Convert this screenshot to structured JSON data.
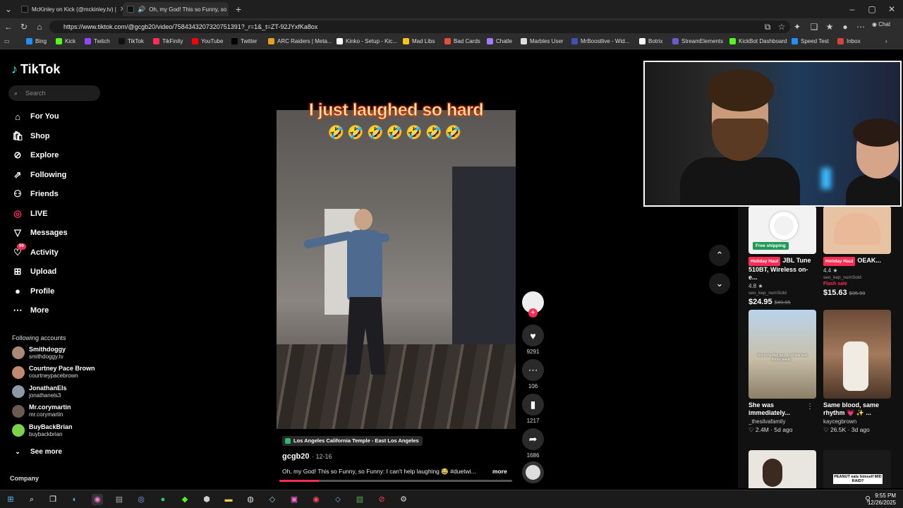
{
  "tabs": [
    {
      "title": "McKinley on Kick (@mckinley.tv) |",
      "active": false
    },
    {
      "title": "Oh, my God! This so Funny, so",
      "active": true
    }
  ],
  "address": {
    "url": "https://www.tiktok.com/@gcgb20/video/7584343207320751391?_r=1&_t=ZT-92JYxfKa8ox"
  },
  "bookmarks": [
    {
      "label": "Bing",
      "color": "#1e90ff"
    },
    {
      "label": "Kick",
      "color": "#53fc18"
    },
    {
      "label": "Twitch",
      "color": "#9146ff"
    },
    {
      "label": "TikTok",
      "color": "#111111"
    },
    {
      "label": "TikFinity",
      "color": "#fe2c55"
    },
    {
      "label": "YouTube",
      "color": "#ff0000"
    },
    {
      "label": "Twitter",
      "color": "#000000"
    },
    {
      "label": "ARC Raiders | Meta...",
      "color": "#e4a11b"
    },
    {
      "label": "Kinko - Setup - Kic...",
      "color": "#ffffff"
    },
    {
      "label": "Mad Libs",
      "color": "#f5c518"
    },
    {
      "label": "Bad Cards",
      "color": "#e74c3c"
    },
    {
      "label": "Chatle",
      "color": "#a27bff"
    },
    {
      "label": "Marbles User",
      "color": "#dddddd"
    },
    {
      "label": "MrBoostlive - Wid...",
      "color": "#3f51b5"
    },
    {
      "label": "Botrix",
      "color": "#ffffff"
    },
    {
      "label": "StreamElements",
      "color": "#6a5acd"
    },
    {
      "label": "KickBot Dashboard",
      "color": "#53fc18"
    },
    {
      "label": "Speed Test",
      "color": "#1e90ff"
    },
    {
      "label": "Inbox",
      "color": "#d44638"
    }
  ],
  "sidebar": {
    "logo": "TikTok",
    "search_placeholder": "Search",
    "nav": [
      {
        "label": "For You",
        "icon": "home-icon"
      },
      {
        "label": "Shop",
        "icon": "shop-icon"
      },
      {
        "label": "Explore",
        "icon": "compass-icon"
      },
      {
        "label": "Following",
        "icon": "following-icon"
      },
      {
        "label": "Friends",
        "icon": "friends-icon"
      },
      {
        "label": "LIVE",
        "icon": "live-icon"
      },
      {
        "label": "Messages",
        "icon": "messages-icon"
      },
      {
        "label": "Activity",
        "icon": "activity-icon",
        "badge": "50"
      },
      {
        "label": "Upload",
        "icon": "upload-icon"
      },
      {
        "label": "Profile",
        "icon": "profile-icon"
      },
      {
        "label": "More",
        "icon": "more-icon"
      }
    ],
    "following_title": "Following accounts",
    "following": [
      {
        "name": "Smithdoggy",
        "handle": "smithdoggy.tv"
      },
      {
        "name": "Courtney Pace Brown",
        "handle": "courtneypacebrown"
      },
      {
        "name": "JonathanEls",
        "handle": "jonathanels3"
      },
      {
        "name": "Mr.corymartin",
        "handle": "mr.corymartin"
      },
      {
        "name": "BuyBackBrian",
        "handle": "buybackbrian"
      }
    ],
    "see_more": "See more",
    "company": "Company"
  },
  "video": {
    "caption": "I just laughed so hard",
    "emojis": "🤣🤣🤣🤣🤣🤣🤣",
    "location": "Los Angeles California Temple - East Los Angeles",
    "author": "gcgb20",
    "date": "· 12-16",
    "description": "Oh, my God! This so Funny, so Funny: I can't help laughing 😂 #duetwi...",
    "more": "more",
    "progress": 0.17
  },
  "actions": {
    "likes": "9291",
    "comments": "106",
    "saves": "1217",
    "shares": "1686"
  },
  "cards": [
    {
      "type": "product",
      "badge": "Holiday Haul",
      "title": "JBL Tune 510BT, Wireless on-e...",
      "rating": "4.8 ★",
      "seller": "seo_kep_numSold",
      "price": "$24.95",
      "old_price": "$49.95",
      "tag": "Free shipping"
    },
    {
      "type": "product",
      "badge": "Holiday Haul",
      "title": "OEAK...",
      "rating": "4.4 ★",
      "seller": "seo_kep_numSold",
      "price": "$15.63",
      "old_price": "$35.99",
      "tag": "Flash sale"
    },
    {
      "type": "video",
      "title": "She was immediately...",
      "author": "_thesilvafamily",
      "stats": "♡ 2.4M · 5d ago",
      "thumb_text": "Not to be that guy... but she was immediately..."
    },
    {
      "type": "video",
      "title": "Same blood, same rhythm 💗 ✨ ...",
      "author": "kaycegbrown",
      "stats": "♡ 26.5K · 3d ago"
    },
    {
      "type": "video",
      "title": "",
      "author": "",
      "stats": ""
    },
    {
      "type": "video",
      "title": "",
      "author": "",
      "stats": "",
      "thumb_text": "PEANUT eats himself MID RAID?"
    }
  ],
  "taskbar": {
    "time": "9:55 PM",
    "date": "12/26/2025"
  }
}
